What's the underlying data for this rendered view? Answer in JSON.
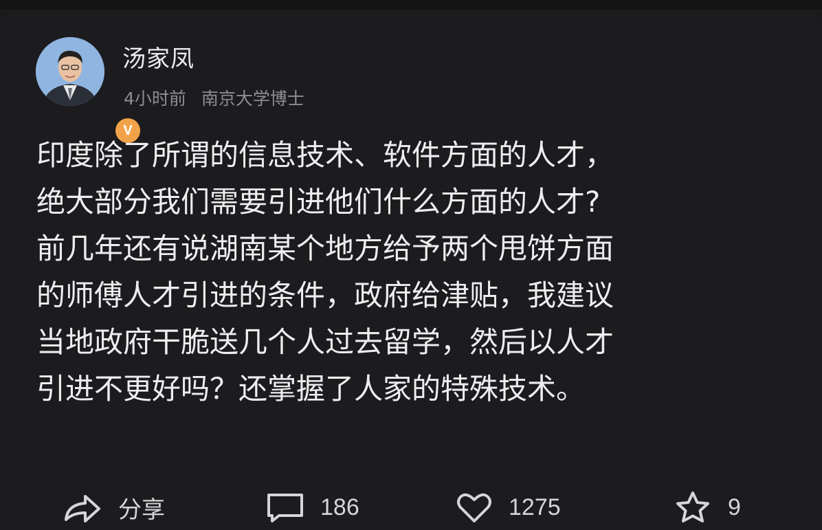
{
  "post": {
    "author": "汤家凤",
    "time": "4小时前",
    "bio": "南京大学博士",
    "verified_badge": "V",
    "lines": [
      "印度除了所谓的信息技术、软件方面的人才，",
      "绝大部分我们需要引进他们什么方面的人才?",
      "前几年还有说湖南某个地方给予两个甩饼方面",
      "的师傅人才引进的条件，政府给津贴，我建议",
      "当地政府干脆送几个人过去留学，然后以人才",
      "引进不更好吗？还掌握了人家的特殊技术。"
    ]
  },
  "actions": {
    "share_label": "分享",
    "comments_count": "186",
    "likes_count": "1275",
    "favorites_count": "9"
  },
  "colors": {
    "background": "#1c1c1e",
    "text": "#eeeef0",
    "meta": "#8e8e92",
    "badge": "#f2a34a"
  }
}
